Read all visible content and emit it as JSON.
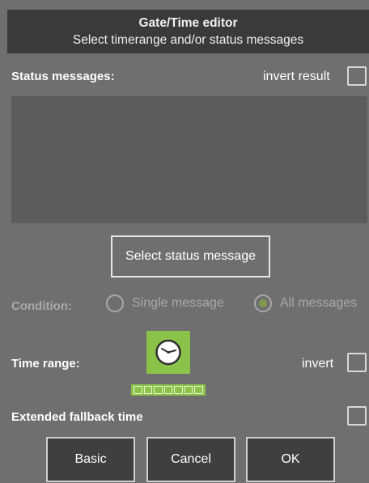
{
  "header": {
    "title": "Gate/Time editor",
    "subtitle": "Select timerange and/or status messages"
  },
  "status": {
    "label": "Status messages:",
    "invert_label": "invert result",
    "invert_checked": false,
    "messages": []
  },
  "select_button": "Select status message",
  "condition": {
    "label": "Condition:",
    "options": [
      {
        "label": "Single message",
        "selected": false
      },
      {
        "label": "All messages",
        "selected": true
      }
    ]
  },
  "time_range": {
    "label": "Time range:",
    "icon": "clock-icon",
    "invert_label": "invert",
    "invert_checked": false,
    "segments": 7
  },
  "extended_fallback": {
    "label": "Extended fallback time",
    "checked": false
  },
  "buttons": {
    "basic": "Basic",
    "cancel": "Cancel",
    "ok": "OK"
  },
  "colors": {
    "background": "#6f6f6f",
    "header": "#3a3a3a",
    "accent_green": "#8bc34a"
  }
}
